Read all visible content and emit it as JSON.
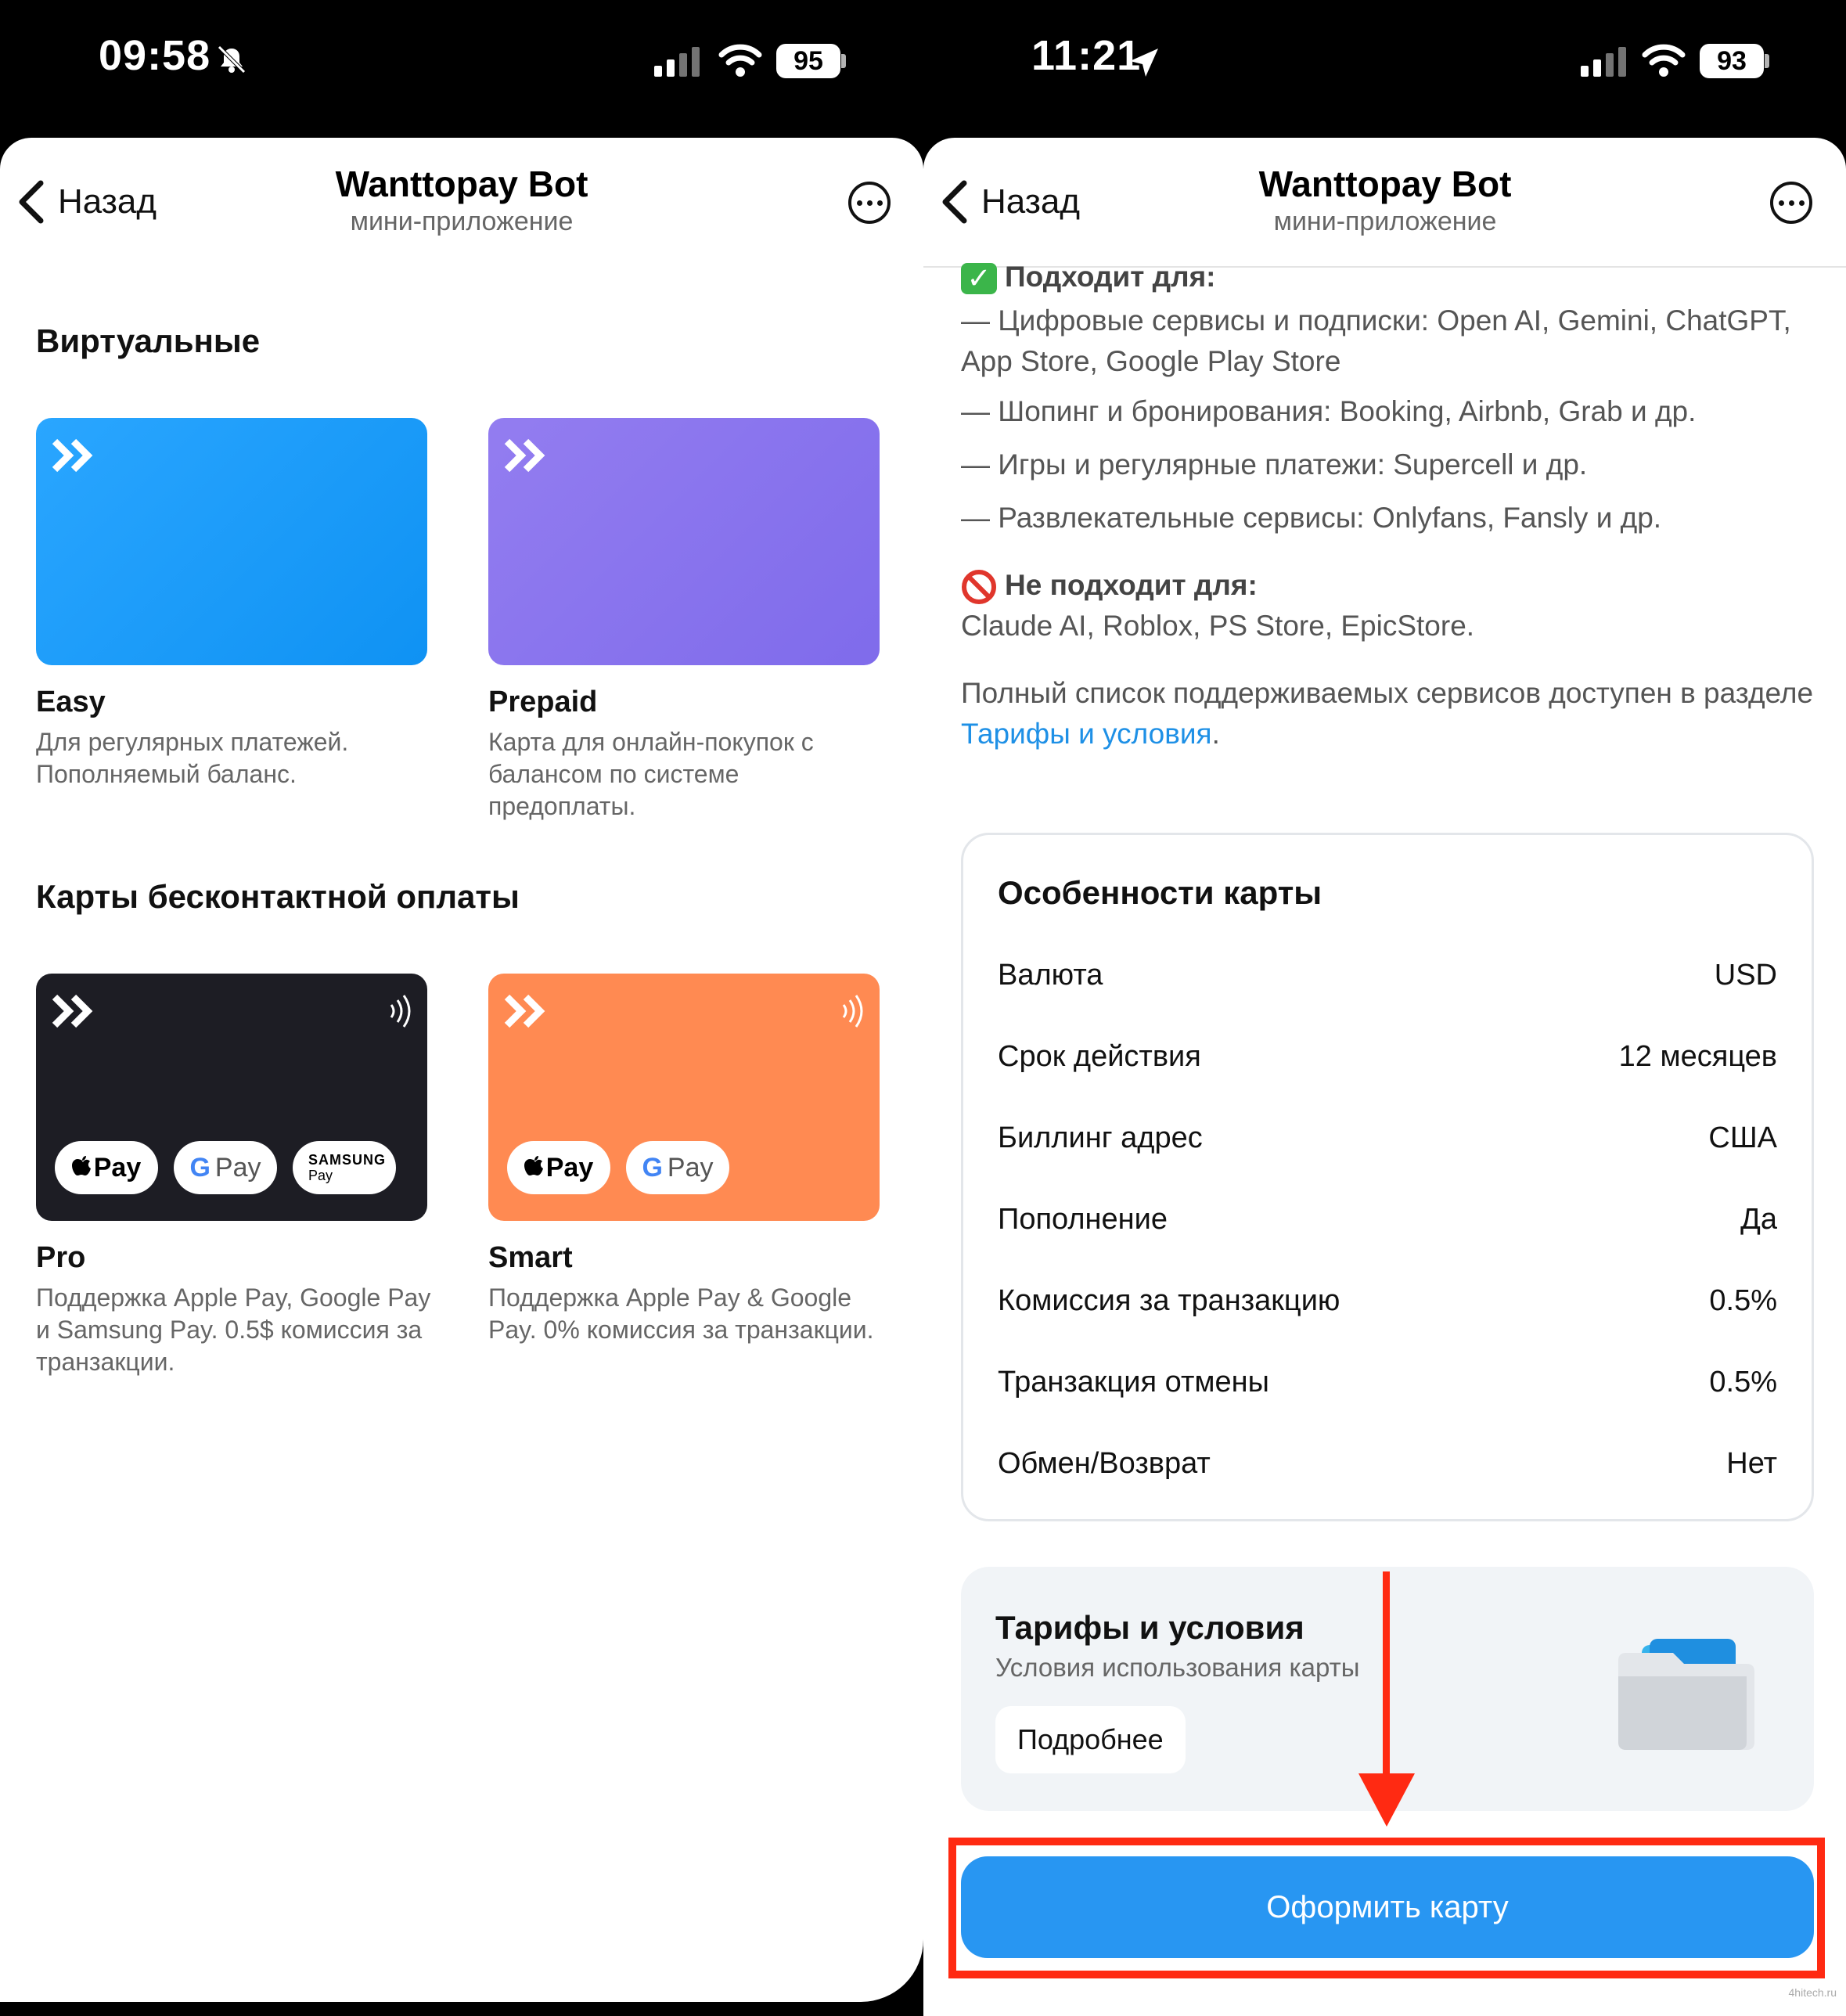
{
  "left": {
    "status": {
      "time": "09:58",
      "battery": "95"
    },
    "header": {
      "back": "Назад",
      "title": "Wanttopay Bot",
      "subtitle": "мини-приложение"
    },
    "virtual_title": "Виртуальные",
    "virtual_cards": [
      {
        "name": "Easy",
        "desc": "Для регулярных платежей. Пополняемый баланс."
      },
      {
        "name": "Prepaid",
        "desc": "Карта для онлайн-покупок с балансом по системе предоплаты."
      }
    ],
    "contactless_title": "Карты бесконтактной оплаты",
    "contactless_cards": [
      {
        "name": "Pro",
        "desc": "Поддержка Apple Pay, Google Pay и Samsung Pay. 0.5$ комиссия за транзакции."
      },
      {
        "name": "Smart",
        "desc": "Поддержка Apple Pay & Google Pay. 0% комиссия за транзакции."
      }
    ],
    "pay_badges": {
      "apple": "Pay",
      "google": "Pay",
      "samsung_top": "SAMSUNG",
      "samsung_bottom": "Pay"
    }
  },
  "right": {
    "status": {
      "time": "11:21",
      "battery": "93"
    },
    "header": {
      "back": "Назад",
      "title": "Wanttopay Bot",
      "subtitle": "мини-приложение"
    },
    "suitable_heading": "Подходит для:",
    "suitable": [
      "— Цифровые сервисы и подписки: Open AI, Gemini, ChatGPT, App Store, Google Play Store",
      "— Шопинг и бронирования: Booking, Airbnb, Grab и др.",
      "— Игры и регулярные платежи: Supercell и др.",
      "— Развлекательные сервисы: Onlyfans, Fansly и др."
    ],
    "not_suitable_heading": "Не подходит для:",
    "not_suitable": "Claude AI, Roblox, PS Store, EpicStore.",
    "full_list_prefix": "Полный список поддерживаемых сервисов доступен в разделе ",
    "full_list_link": "Тарифы и условия",
    "full_list_suffix": ".",
    "features_title": "Особенности карты",
    "features": [
      {
        "label": "Валюта",
        "value": "USD"
      },
      {
        "label": "Срок действия",
        "value": "12 месяцев"
      },
      {
        "label": "Биллинг адрес",
        "value": "США"
      },
      {
        "label": "Пополнение",
        "value": "Да"
      },
      {
        "label": "Комиссия за транзакцию",
        "value": "0.5%"
      },
      {
        "label": "Транзакция отмены",
        "value": "0.5%"
      },
      {
        "label": "Обмен/Возврат",
        "value": "Нет"
      }
    ],
    "terms_title": "Тарифы и условия",
    "terms_subtitle": "Условия использования карты",
    "terms_button": "Подробнее",
    "primary_button": "Оформить карту"
  },
  "watermark": "4hitech.ru",
  "colors": {
    "easy": "#1a9cf5",
    "prepaid": "#8a74ec",
    "pro": "#1d1d24",
    "smart": "#ff8a52",
    "accent": "#2896f2",
    "highlight": "#ff2a12"
  }
}
